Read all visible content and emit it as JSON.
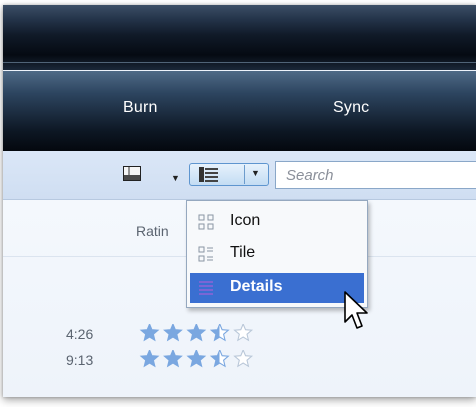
{
  "tabs": {
    "burn": "Burn",
    "sync": "Sync"
  },
  "toolbar": {
    "layout_icon": "layout-pane-icon",
    "view_icon": "details-view-icon",
    "search_placeholder": "Search"
  },
  "view_menu": {
    "items": [
      {
        "label": "Icon",
        "icon": "icon-view-icon"
      },
      {
        "label": "Tile",
        "icon": "tile-view-icon"
      },
      {
        "label": "Details",
        "icon": "details-view-icon",
        "selected": true
      }
    ]
  },
  "list": {
    "column_header": "Ratin",
    "rows": [
      {
        "length": "4:26",
        "rating": 3.5,
        "max_rating": 5
      },
      {
        "length": "9:13",
        "rating": 3.5,
        "max_rating": 5
      }
    ]
  },
  "colors": {
    "highlight": "#3a6fd1",
    "star": "#7aa7e0"
  }
}
